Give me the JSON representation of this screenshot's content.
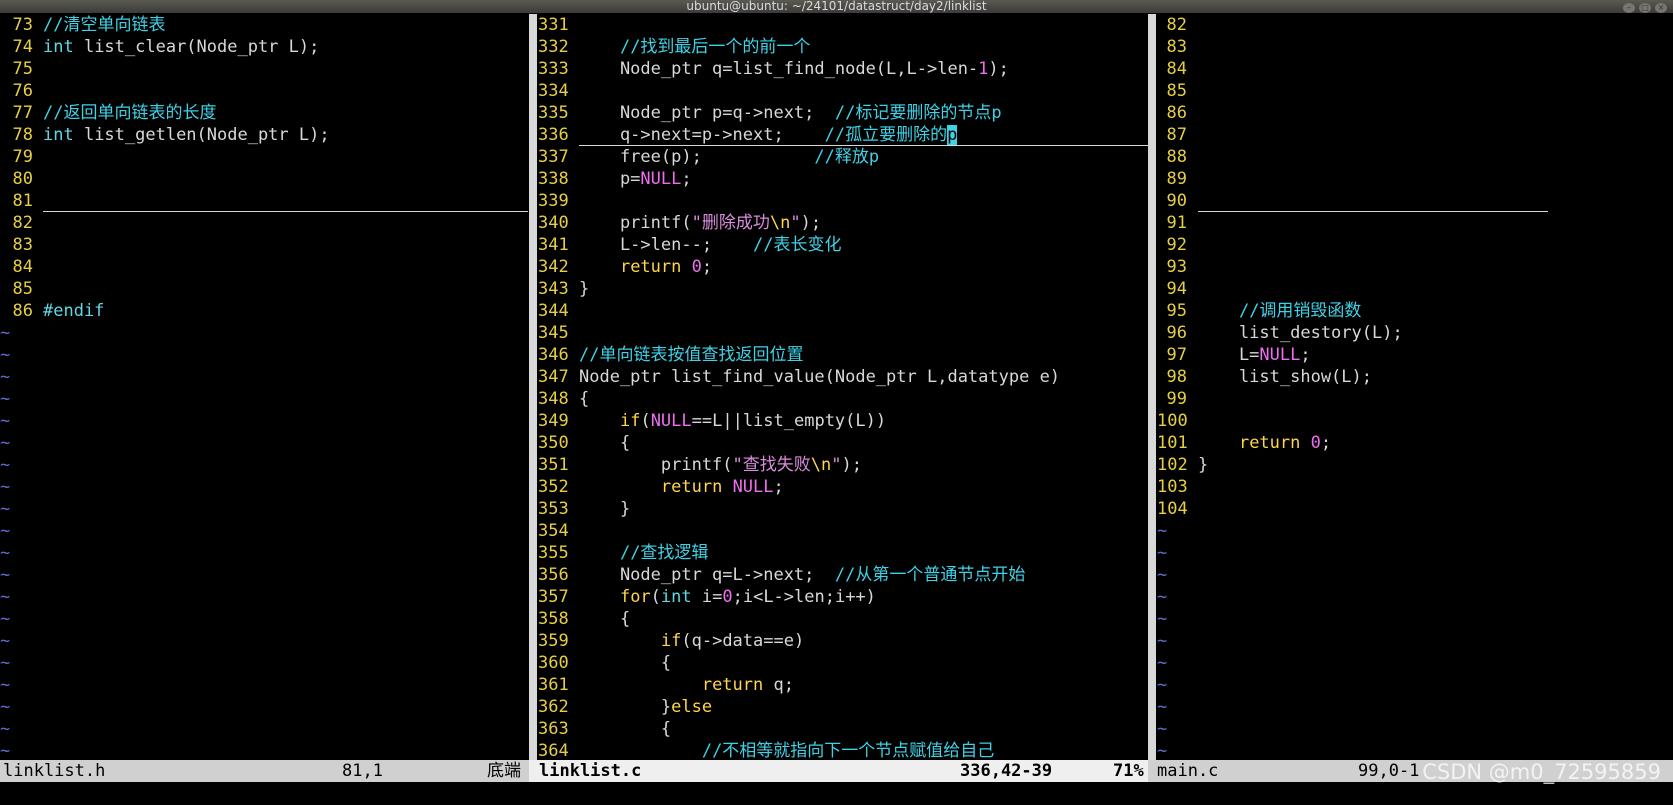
{
  "window": {
    "title": "ubuntu@ubuntu: ~/24101/datastruct/day2/linklist"
  },
  "panes": [
    {
      "file": "linklist.h",
      "lines": [
        {
          "n": "73",
          "tokens": [
            [
              "cmt",
              "//清空单向链表"
            ]
          ]
        },
        {
          "n": "74",
          "tokens": [
            [
              "type",
              "int"
            ],
            [
              "plain",
              " list_clear(Node_ptr L);"
            ]
          ]
        },
        {
          "n": "75",
          "tokens": []
        },
        {
          "n": "76",
          "tokens": []
        },
        {
          "n": "77",
          "tokens": [
            [
              "cmt",
              "//返回单向链表的长度"
            ]
          ]
        },
        {
          "n": "78",
          "tokens": [
            [
              "type",
              "int"
            ],
            [
              "plain",
              " list_getlen(Node_ptr L);"
            ]
          ]
        },
        {
          "n": "79",
          "tokens": []
        },
        {
          "n": "80",
          "tokens": []
        },
        {
          "n": "81",
          "tokens": []
        },
        {
          "n": "82",
          "tokens": []
        },
        {
          "n": "83",
          "tokens": []
        },
        {
          "n": "84",
          "tokens": []
        },
        {
          "n": "85",
          "tokens": []
        },
        {
          "n": "86",
          "tokens": [
            [
              "pre",
              "#endif"
            ]
          ]
        }
      ],
      "tildes": 20,
      "status": {
        "name": "linklist.h",
        "pos": "81,1",
        "pct": "底端"
      }
    },
    {
      "file": "linklist.c",
      "lines": [
        {
          "n": "331",
          "tokens": []
        },
        {
          "n": "332",
          "tokens": [
            [
              "plain",
              "    "
            ],
            [
              "cmt",
              "//找到最后一个的前一个"
            ]
          ]
        },
        {
          "n": "333",
          "tokens": [
            [
              "plain",
              "    Node_ptr q=list_find_node(L,L->len-"
            ],
            [
              "num",
              "1"
            ],
            [
              "plain",
              ");"
            ]
          ]
        },
        {
          "n": "334",
          "tokens": []
        },
        {
          "n": "335",
          "tokens": [
            [
              "plain",
              "    Node_ptr p=q->next;  "
            ],
            [
              "cmt",
              "//标记要删除的节点p"
            ]
          ]
        },
        {
          "n": "336",
          "tokens": [
            [
              "plain",
              "    q->next=p->next;    "
            ],
            [
              "cmt",
              "//孤立要删除的"
            ],
            [
              "cursor",
              "p"
            ]
          ]
        },
        {
          "n": "337",
          "tokens": [
            [
              "plain",
              "    free(p);           "
            ],
            [
              "cmt",
              "//释放p"
            ]
          ]
        },
        {
          "n": "338",
          "tokens": [
            [
              "plain",
              "    p="
            ],
            [
              "const",
              "NULL"
            ],
            [
              "plain",
              ";"
            ]
          ]
        },
        {
          "n": "339",
          "tokens": []
        },
        {
          "n": "340",
          "tokens": [
            [
              "plain",
              "    printf("
            ],
            [
              "str",
              "\"删除成功"
            ],
            [
              "esc",
              "\\n"
            ],
            [
              "str",
              "\""
            ],
            [
              "plain",
              ");"
            ]
          ]
        },
        {
          "n": "341",
          "tokens": [
            [
              "plain",
              "    L->len--;    "
            ],
            [
              "cmt",
              "//表长变化"
            ]
          ]
        },
        {
          "n": "342",
          "tokens": [
            [
              "plain",
              "    "
            ],
            [
              "kw",
              "return"
            ],
            [
              "plain",
              " "
            ],
            [
              "num",
              "0"
            ],
            [
              "plain",
              ";"
            ]
          ]
        },
        {
          "n": "343",
          "tokens": [
            [
              "plain",
              "}"
            ]
          ]
        },
        {
          "n": "344",
          "tokens": []
        },
        {
          "n": "345",
          "tokens": []
        },
        {
          "n": "346",
          "tokens": [
            [
              "cmt",
              "//单向链表按值查找返回位置"
            ]
          ]
        },
        {
          "n": "347",
          "tokens": [
            [
              "plain",
              "Node_ptr list_find_value(Node_ptr L,datatype e)"
            ]
          ]
        },
        {
          "n": "348",
          "tokens": [
            [
              "plain",
              "{"
            ]
          ]
        },
        {
          "n": "349",
          "tokens": [
            [
              "plain",
              "    "
            ],
            [
              "kw",
              "if"
            ],
            [
              "plain",
              "("
            ],
            [
              "const",
              "NULL"
            ],
            [
              "plain",
              "==L||list_empty(L))"
            ]
          ]
        },
        {
          "n": "350",
          "tokens": [
            [
              "plain",
              "    {"
            ]
          ]
        },
        {
          "n": "351",
          "tokens": [
            [
              "plain",
              "        printf("
            ],
            [
              "str",
              "\"查找失败"
            ],
            [
              "esc",
              "\\n"
            ],
            [
              "str",
              "\""
            ],
            [
              "plain",
              ");"
            ]
          ]
        },
        {
          "n": "352",
          "tokens": [
            [
              "plain",
              "        "
            ],
            [
              "kw",
              "return"
            ],
            [
              "plain",
              " "
            ],
            [
              "const",
              "NULL"
            ],
            [
              "plain",
              ";"
            ]
          ]
        },
        {
          "n": "353",
          "tokens": [
            [
              "plain",
              "    }"
            ]
          ]
        },
        {
          "n": "354",
          "tokens": []
        },
        {
          "n": "355",
          "tokens": [
            [
              "plain",
              "    "
            ],
            [
              "cmt",
              "//查找逻辑"
            ]
          ]
        },
        {
          "n": "356",
          "tokens": [
            [
              "plain",
              "    Node_ptr q=L->next;  "
            ],
            [
              "cmt",
              "//从第一个普通节点开始"
            ]
          ]
        },
        {
          "n": "357",
          "tokens": [
            [
              "plain",
              "    "
            ],
            [
              "kw",
              "for"
            ],
            [
              "plain",
              "("
            ],
            [
              "type",
              "int"
            ],
            [
              "plain",
              " i="
            ],
            [
              "num",
              "0"
            ],
            [
              "plain",
              ";i<L->len;i++)"
            ]
          ]
        },
        {
          "n": "358",
          "tokens": [
            [
              "plain",
              "    {"
            ]
          ]
        },
        {
          "n": "359",
          "tokens": [
            [
              "plain",
              "        "
            ],
            [
              "kw",
              "if"
            ],
            [
              "plain",
              "(q->data==e)"
            ]
          ]
        },
        {
          "n": "360",
          "tokens": [
            [
              "plain",
              "        {"
            ]
          ]
        },
        {
          "n": "361",
          "tokens": [
            [
              "plain",
              "            "
            ],
            [
              "kw",
              "return"
            ],
            [
              "plain",
              " q;"
            ]
          ]
        },
        {
          "n": "362",
          "tokens": [
            [
              "plain",
              "        }"
            ],
            [
              "kw",
              "else"
            ]
          ]
        },
        {
          "n": "363",
          "tokens": [
            [
              "plain",
              "        {"
            ]
          ]
        },
        {
          "n": "364",
          "tokens": [
            [
              "plain",
              "            "
            ],
            [
              "cmt",
              "//不相等就指向下一个节点赋值给自己"
            ]
          ]
        }
      ],
      "tildes": 0,
      "status": {
        "name": "linklist.c",
        "pos": "336,42-39",
        "pct": "71%"
      }
    },
    {
      "file": "main.c",
      "lines": [
        {
          "n": "82",
          "tokens": []
        },
        {
          "n": "83",
          "tokens": []
        },
        {
          "n": "84",
          "tokens": []
        },
        {
          "n": "85",
          "tokens": []
        },
        {
          "n": "86",
          "tokens": []
        },
        {
          "n": "87",
          "tokens": []
        },
        {
          "n": "88",
          "tokens": []
        },
        {
          "n": "89",
          "tokens": []
        },
        {
          "n": "90",
          "tokens": []
        },
        {
          "n": "91",
          "tokens": []
        },
        {
          "n": "92",
          "tokens": []
        },
        {
          "n": "93",
          "tokens": []
        },
        {
          "n": "94",
          "tokens": []
        },
        {
          "n": "95",
          "tokens": [
            [
              "plain",
              "    "
            ],
            [
              "cmt",
              "//调用销毁函数"
            ]
          ]
        },
        {
          "n": "96",
          "tokens": [
            [
              "plain",
              "    list_destory(L);"
            ]
          ]
        },
        {
          "n": "97",
          "tokens": [
            [
              "plain",
              "    L="
            ],
            [
              "const",
              "NULL"
            ],
            [
              "plain",
              ";"
            ]
          ]
        },
        {
          "n": "98",
          "tokens": [
            [
              "plain",
              "    list_show(L);"
            ]
          ]
        },
        {
          "n": "99",
          "tokens": []
        },
        {
          "n": "100",
          "tokens": []
        },
        {
          "n": "101",
          "tokens": [
            [
              "plain",
              "    "
            ],
            [
              "kw",
              "return"
            ],
            [
              "plain",
              " "
            ],
            [
              "num",
              "0"
            ],
            [
              "plain",
              ";"
            ]
          ]
        },
        {
          "n": "102",
          "tokens": [
            [
              "plain",
              "}"
            ]
          ]
        },
        {
          "n": "103",
          "tokens": []
        },
        {
          "n": "104",
          "tokens": []
        }
      ],
      "tildes": 11,
      "status": {
        "name": "main.c",
        "pos": "99,0-1",
        "pct": ""
      }
    }
  ],
  "watermark": "CSDN @m0_72595859"
}
